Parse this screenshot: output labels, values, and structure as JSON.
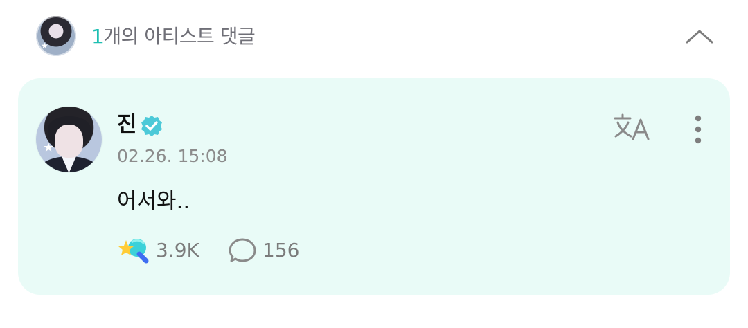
{
  "header": {
    "count": "1",
    "title_suffix": "개의 아티스트 댓글",
    "collapse_icon": "chevron-up-icon"
  },
  "comment": {
    "author": "진",
    "verified_icon": "verified-icon",
    "timestamp": "02.26. 15:08",
    "message": "어서와..",
    "translate_icon": "translate-icon",
    "more_icon": "more-vertical-icon",
    "like_count": "3.9K",
    "reply_count": "156",
    "colors": {
      "card_background": "#e9fbf7",
      "accent": "#1ebfb2",
      "verified": "#4cc9d8"
    }
  }
}
